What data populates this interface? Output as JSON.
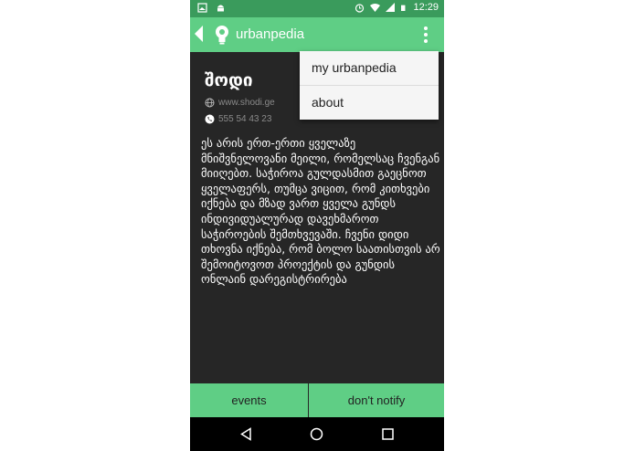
{
  "status_bar": {
    "time": "12:29"
  },
  "app_bar": {
    "title": "urbanpedia"
  },
  "overflow_menu": {
    "items": [
      "my urbanpedia",
      "about"
    ]
  },
  "place": {
    "name": "შოდი",
    "website": "www.shodi.ge",
    "phone": "555 54 43 23",
    "description": "ეს არის ერთ-ერთი ყველაზე მნიშვნელოვანი მეილი, რომელსაც ჩვენგან მიიღებთ. საჭიროა გულდასმით გაეცნოთ ყველაფერს, თუმცა ვიცით, რომ კითხვები იქნება და მზად ვართ ყველა გუნდს ინდივიდუალურად დავეხმაროთ საჭიროების შემთხვევაში. ჩვენი დიდი თხოვნა იქნება, რომ ბოლო საათისთვის არ შემოიტოვოთ პროექტის და გუნდის ონლაინ დარეგისტრირება"
  },
  "buttons": {
    "events": "events",
    "dont_notify": "don't notify"
  },
  "colors": {
    "accent": "#5fce85",
    "status_bar": "#3a9b5c",
    "background": "#262626"
  }
}
